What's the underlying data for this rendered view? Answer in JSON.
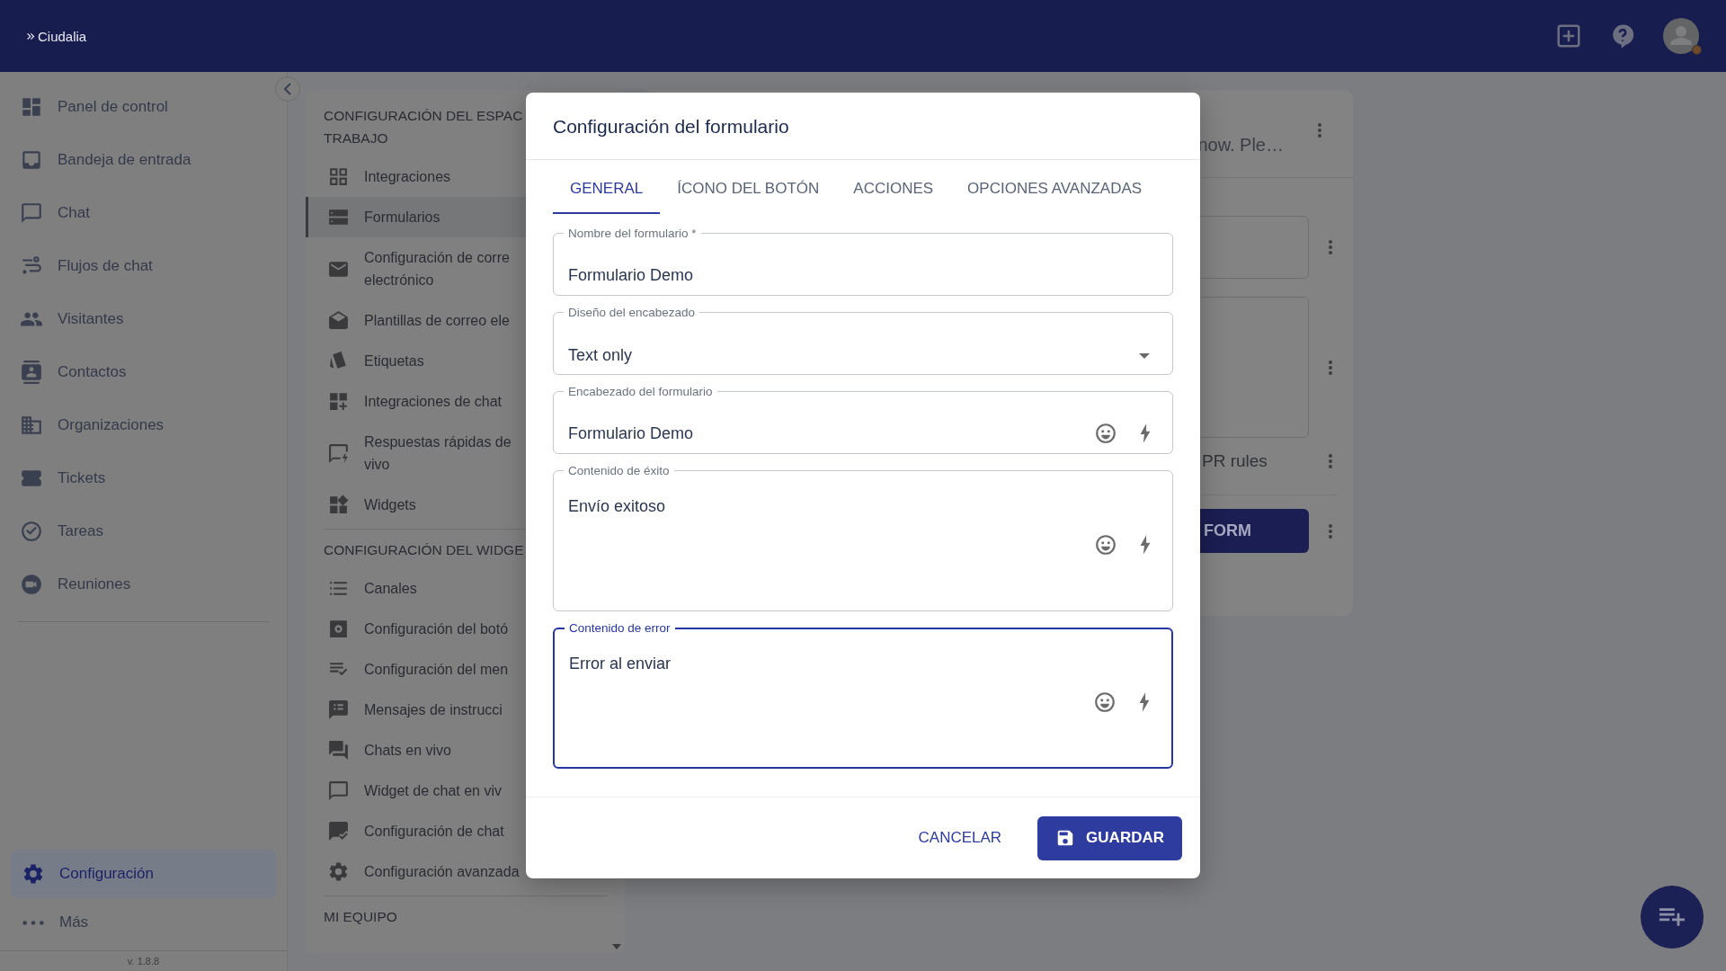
{
  "header": {
    "logo": "Ciudalia"
  },
  "sidebar": {
    "items": [
      {
        "label": "Panel de control",
        "selected": false
      },
      {
        "label": "Bandeja de entrada",
        "selected": false
      },
      {
        "label": "Chat",
        "selected": false
      },
      {
        "label": "Flujos de chat",
        "selected": false
      },
      {
        "label": "Visitantes",
        "selected": false
      },
      {
        "label": "Contactos",
        "selected": false
      },
      {
        "label": "Organizaciones",
        "selected": false
      },
      {
        "label": "Tickets",
        "selected": false
      },
      {
        "label": "Tareas",
        "selected": false
      },
      {
        "label": "Reuniones",
        "selected": false
      }
    ],
    "bottom_items": [
      {
        "label": "Configuración",
        "selected": true
      },
      {
        "label": "Más",
        "selected": false
      }
    ],
    "version": "v. 1.8.8"
  },
  "settings_panel": {
    "sections": [
      {
        "heading": [
          "CONFIGURACIÓN DEL ESPAC",
          "TRABAJO"
        ],
        "items": [
          {
            "lines": [
              "Integraciones"
            ],
            "selected": false
          },
          {
            "lines": [
              "Formularios"
            ],
            "selected": true
          },
          {
            "lines": [
              "Configuración de corre",
              "electrónico"
            ],
            "selected": false
          },
          {
            "lines": [
              "Plantillas de correo ele"
            ],
            "selected": false
          },
          {
            "lines": [
              "Etiquetas"
            ],
            "selected": false
          },
          {
            "lines": [
              "Integraciones de chat"
            ],
            "selected": false
          },
          {
            "lines": [
              "Respuestas rápidas de",
              "vivo"
            ],
            "selected": false
          },
          {
            "lines": [
              "Widgets"
            ],
            "selected": false
          }
        ]
      },
      {
        "heading": [
          "CONFIGURACIÓN DEL WIDGE"
        ],
        "items": [
          {
            "lines": [
              "Canales"
            ],
            "selected": false
          },
          {
            "lines": [
              "Configuración del botó"
            ],
            "selected": false
          },
          {
            "lines": [
              "Configuración del men"
            ],
            "selected": false
          },
          {
            "lines": [
              "Mensajes de instrucci"
            ],
            "selected": false
          },
          {
            "lines": [
              "Chats en vivo"
            ],
            "selected": false
          },
          {
            "lines": [
              "Widget de chat en viv"
            ],
            "selected": false
          },
          {
            "lines": [
              "Configuración de chat"
            ],
            "selected": false
          },
          {
            "lines": [
              "Configuración avanzada"
            ],
            "selected": false
          }
        ]
      },
      {
        "heading": [
          "MI EQUIPO"
        ]
      }
    ]
  },
  "form_card": {
    "title": "now. Ple…",
    "rows": [
      {
        "kind": "field"
      },
      {
        "kind": "area"
      },
      {
        "kind": "text",
        "text": "PR rules"
      },
      {
        "kind": "button",
        "text": "FORM"
      }
    ]
  },
  "dialog": {
    "title": "Configuración del formulario",
    "tabs": [
      {
        "label": "GENERAL",
        "selected": true
      },
      {
        "label": "ÍCONO DEL BOTÓN",
        "selected": false
      },
      {
        "label": "ACCIONES",
        "selected": false
      },
      {
        "label": "OPCIONES AVANZADAS",
        "selected": false
      }
    ],
    "fields": [
      {
        "kind": "text",
        "label": "Nombre del formulario *",
        "value": "Formulario Demo",
        "focused": false
      },
      {
        "kind": "select",
        "label": "Diseño del encabezado",
        "value": "Text only",
        "focused": false
      },
      {
        "kind": "rich-text",
        "label": "Encabezado del formulario",
        "value": "Formulario Demo",
        "focused": false
      },
      {
        "kind": "rich-area",
        "label": "Contenido de éxito",
        "value": "Envío exitoso",
        "focused": false
      },
      {
        "kind": "rich-area",
        "label": "Contenido de error",
        "value": "Error al enviar",
        "focused": true
      }
    ],
    "buttons": [
      {
        "kind": "text",
        "label": "CANCELAR"
      },
      {
        "kind": "primary",
        "label": "GUARDAR"
      }
    ]
  }
}
